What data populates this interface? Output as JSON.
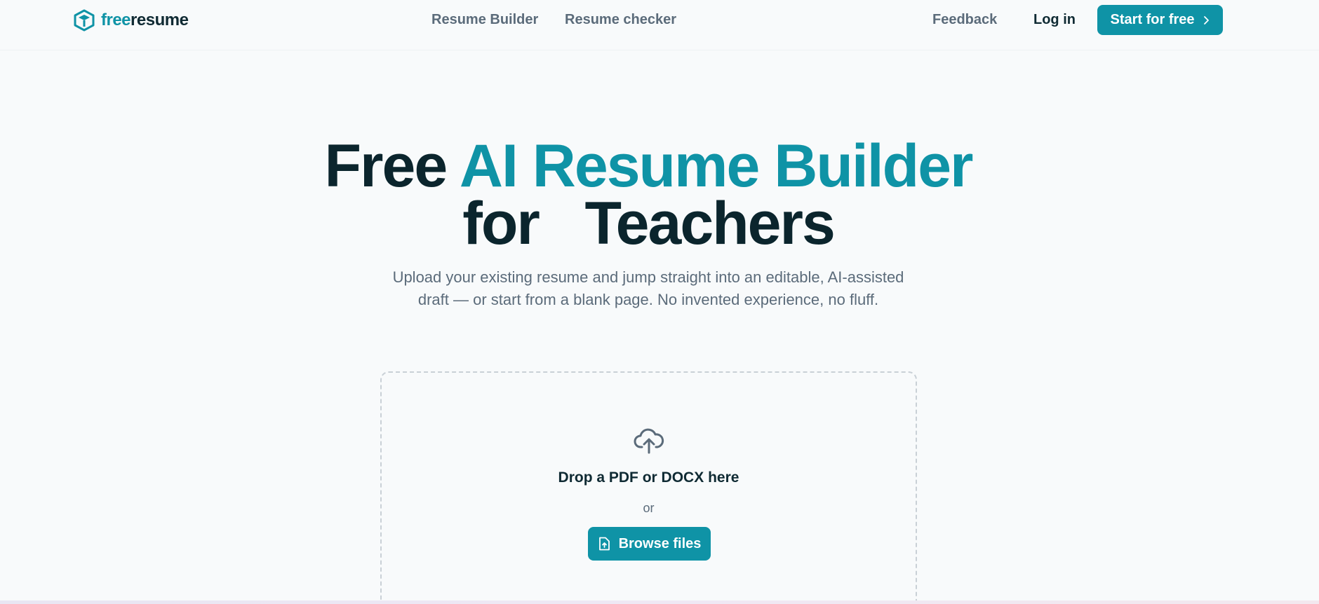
{
  "brand": {
    "logo_part1": "free",
    "logo_part2": "resume",
    "accent_color": "#0f93a6",
    "dark_color": "#0b252d"
  },
  "nav": {
    "links": [
      "Resume Builder",
      "Resume checker"
    ],
    "feedback": "Feedback",
    "login": "Log in",
    "cta": "Start for free",
    "cta_icon": "chevron-right-icon"
  },
  "hero": {
    "title_word1": "Free",
    "title_accent": "AI Resume Builder",
    "title_line2": "for   Teachers",
    "subtitle": "Upload your existing resume and jump straight into an editable, AI-assisted draft — or start from a blank page. No invented experience, no fluff."
  },
  "upload": {
    "icon": "cloud-upload-icon",
    "title": "Drop a PDF or DOCX here",
    "or": "or",
    "browse_label": "Browse files",
    "browse_icon": "file-upload-icon"
  }
}
